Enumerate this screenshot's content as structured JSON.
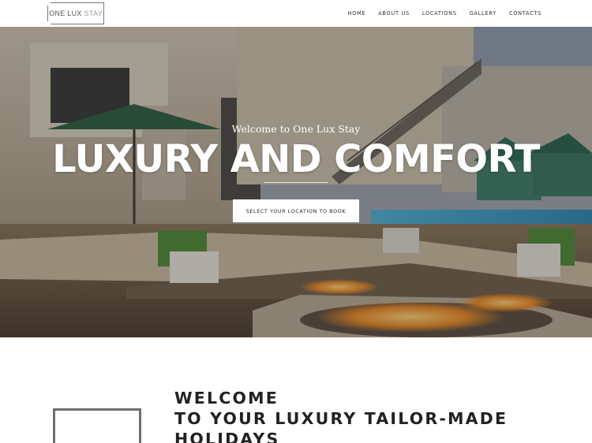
{
  "brand": {
    "logo_text_main": "ONE LUX",
    "logo_text_light": "STAY"
  },
  "nav": {
    "items": [
      {
        "label": "HOME"
      },
      {
        "label": "ABOUT US"
      },
      {
        "label": "LOCATIONS"
      },
      {
        "label": "GALLERY"
      },
      {
        "label": "CONTACTS"
      }
    ]
  },
  "hero": {
    "eyebrow": "Welcome to One Lux Stay",
    "title": "LUXURY AND COMFORT",
    "cta_label": "SELECT YOUR LOCATION TO BOOK"
  },
  "welcome": {
    "line1": "WELCOME",
    "line2": "TO YOUR LUXURY TAILOR-MADE",
    "line3": "HOLIDAYS"
  },
  "colors": {
    "text_dark": "#222222",
    "nav_text": "#333333",
    "hero_text": "#ffffff",
    "cta_bg": "#ffffff",
    "accent_frame": "#6e6e6e"
  }
}
